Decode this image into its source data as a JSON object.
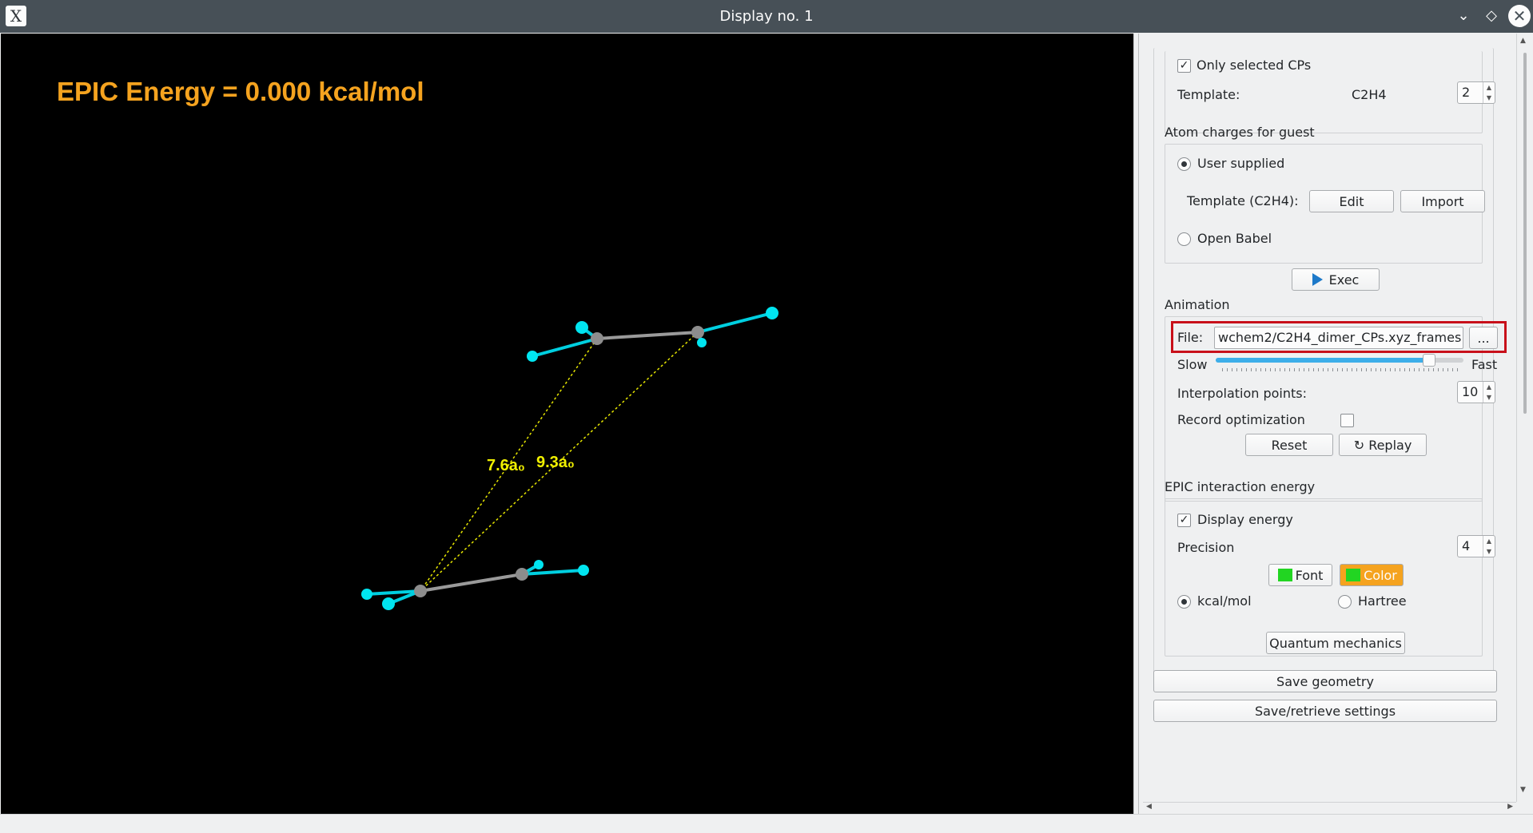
{
  "window": {
    "title": "Display no. 1",
    "app_icon_glyph": "X",
    "controls": [
      "chevron-down-icon",
      "diamond-icon",
      "close-icon"
    ]
  },
  "viewport": {
    "energy_label": "EPIC Energy = 0.000 kcal/mol",
    "energy_color": "#f5a31f",
    "distances": [
      "7.6a₀",
      "9.3a₀"
    ]
  },
  "panel": {
    "only_selected_cps": {
      "label": "Only selected CPs",
      "checked": true
    },
    "template": {
      "label": "Template:",
      "value": "C2H4",
      "spin": "2"
    },
    "atom_charges": {
      "title": "Atom charges for guest",
      "user_supplied": "User supplied",
      "template_label": "Template (C2H4):",
      "edit": "Edit",
      "import": "Import",
      "open_babel": "Open Babel"
    },
    "exec": "Exec",
    "animation": {
      "title": "Animation",
      "file_label": "File:",
      "file_value": "wchem2/C2H4_dimer_CPs.xyz_frames",
      "browse": "...",
      "slow": "Slow",
      "fast": "Fast",
      "speed_fraction": 0.86,
      "interp_label": "Interpolation points:",
      "interp_value": "10",
      "record_label": "Record optimization",
      "reset": "Reset",
      "replay": "Replay"
    },
    "epic": {
      "title": "EPIC interaction energy",
      "display_energy": "Display energy",
      "precision_label": "Precision",
      "precision_value": "4",
      "font": "Font",
      "color": "Color",
      "kcal": "kcal/mol",
      "hartree": "Hartree"
    },
    "quantum": "Quantum mechanics",
    "save_geometry": "Save geometry",
    "save_settings": "Save/retrieve settings"
  }
}
